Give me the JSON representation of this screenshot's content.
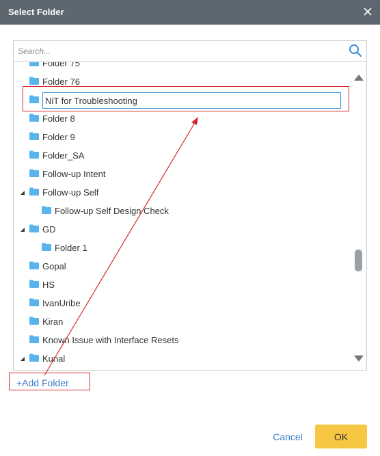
{
  "dialog": {
    "title": "Select Folder",
    "close_icon": "close-icon"
  },
  "search": {
    "placeholder": "Search...",
    "icon": "search-icon"
  },
  "tree": {
    "partial_top_label": "Folder 75",
    "items": [
      {
        "label": "Folder 76",
        "level": 0,
        "toggle": "none"
      },
      {
        "label": "NiT for Troubleshooting",
        "level": 0,
        "toggle": "none",
        "editing": true
      },
      {
        "label": "Folder 8",
        "level": 0,
        "toggle": "none"
      },
      {
        "label": "Folder 9",
        "level": 0,
        "toggle": "none"
      },
      {
        "label": "Folder_SA",
        "level": 0,
        "toggle": "none"
      },
      {
        "label": "Follow-up Intent",
        "level": 0,
        "toggle": "none"
      },
      {
        "label": "Follow-up Self",
        "level": 0,
        "toggle": "expanded"
      },
      {
        "label": "Follow-up Self Design Check",
        "level": 1,
        "toggle": "none"
      },
      {
        "label": "GD",
        "level": 0,
        "toggle": "expanded"
      },
      {
        "label": "Folder 1",
        "level": 1,
        "toggle": "none"
      },
      {
        "label": "Gopal",
        "level": 0,
        "toggle": "none"
      },
      {
        "label": "HS",
        "level": 0,
        "toggle": "none"
      },
      {
        "label": "IvanUribe",
        "level": 0,
        "toggle": "none"
      },
      {
        "label": "Kiran",
        "level": 0,
        "toggle": "none"
      },
      {
        "label": "Known Issue with Interface Resets",
        "level": 0,
        "toggle": "none"
      },
      {
        "label": "Kunal",
        "level": 0,
        "toggle": "expanded"
      }
    ]
  },
  "add_folder_label": "+Add Folder",
  "footer": {
    "cancel_label": "Cancel",
    "ok_label": "OK"
  },
  "colors": {
    "titlebar": "#5d6770",
    "folder_icon": "#5ab4ec",
    "link": "#3b7fc4",
    "ok_button": "#f7c744",
    "annotation": "#d6282b"
  }
}
